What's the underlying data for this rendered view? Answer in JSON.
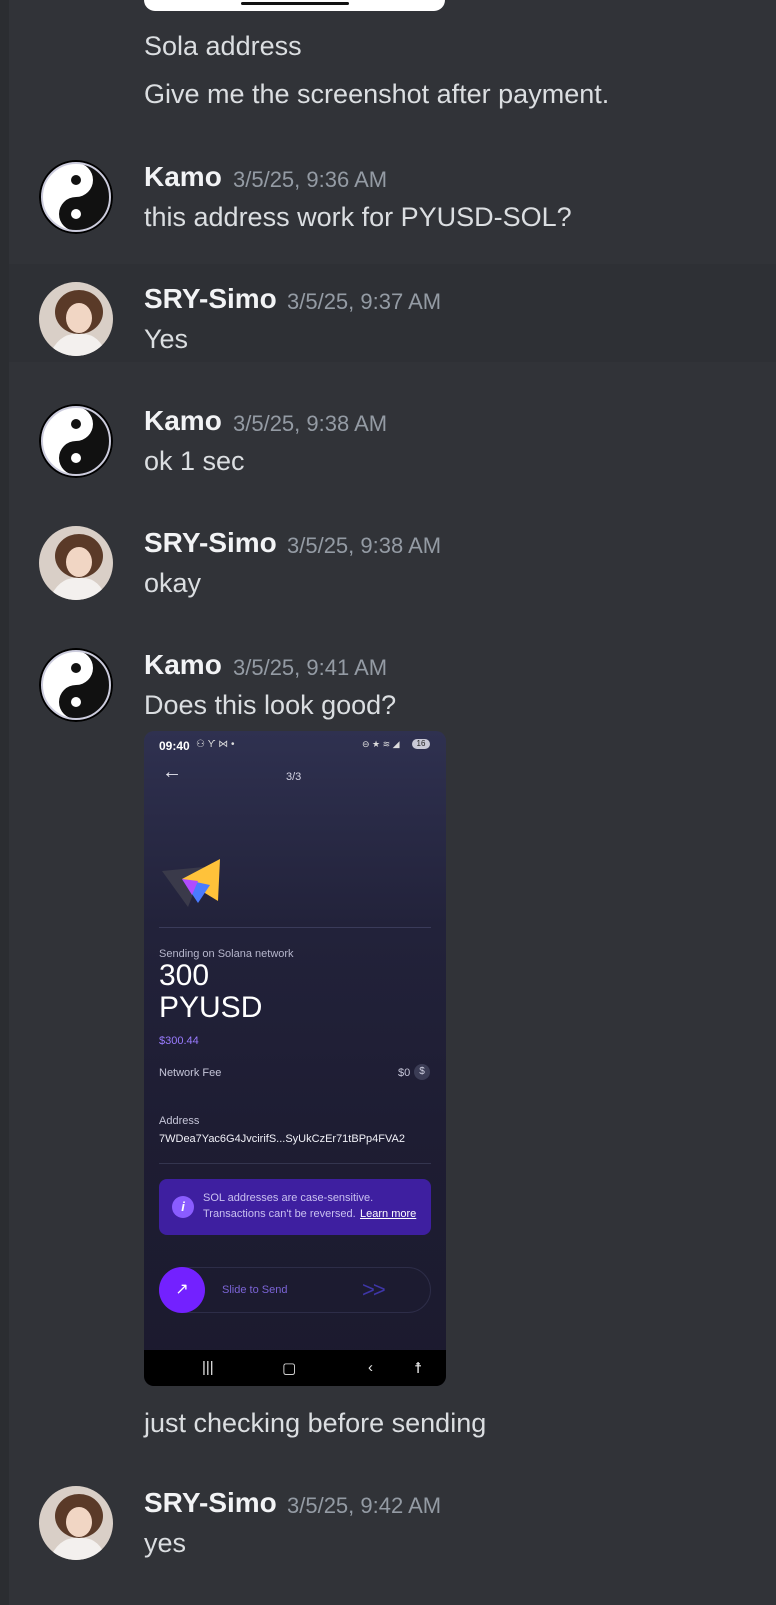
{
  "top_messages": [
    "Sola address",
    "Give me the screenshot after payment."
  ],
  "messages": [
    {
      "author": "Kamo",
      "timestamp": "3/5/25, 9:36 AM",
      "text": "this address work for PYUSD-SOL?"
    },
    {
      "author": "SRY-Simo",
      "timestamp": "3/5/25, 9:37 AM",
      "text": "Yes"
    },
    {
      "author": "Kamo",
      "timestamp": "3/5/25, 9:38 AM",
      "text": "ok 1 sec"
    },
    {
      "author": "SRY-Simo",
      "timestamp": "3/5/25, 9:38 AM",
      "text": "okay"
    },
    {
      "author": "Kamo",
      "timestamp": "3/5/25, 9:41 AM",
      "text": "Does this look good?",
      "followup": "just checking before sending"
    },
    {
      "author": "SRY-Simo",
      "timestamp": "3/5/25, 9:42 AM",
      "text": "yes"
    }
  ],
  "attachment": {
    "status_time": "09:40",
    "battery": "16",
    "step": "3/3",
    "network_label": "Sending on Solana network",
    "amount": "300",
    "token": "PYUSD",
    "usd_value": "$300.44",
    "fee_label": "Network Fee",
    "fee_value": "$0",
    "address_label": "Address",
    "address_value": "7WDea7Yac6G4JvcirifS...SyUkCzEr71tBPp4FVA2",
    "notice_line1": "SOL addresses are case-sensitive.",
    "notice_line2": "Transactions can't be reversed.",
    "learn_more": "Learn more",
    "slide_text": "Slide to Send"
  },
  "colors": {
    "background": "#313338",
    "accent_purple": "#7321ff",
    "notice_bg": "#3e1fa0"
  }
}
